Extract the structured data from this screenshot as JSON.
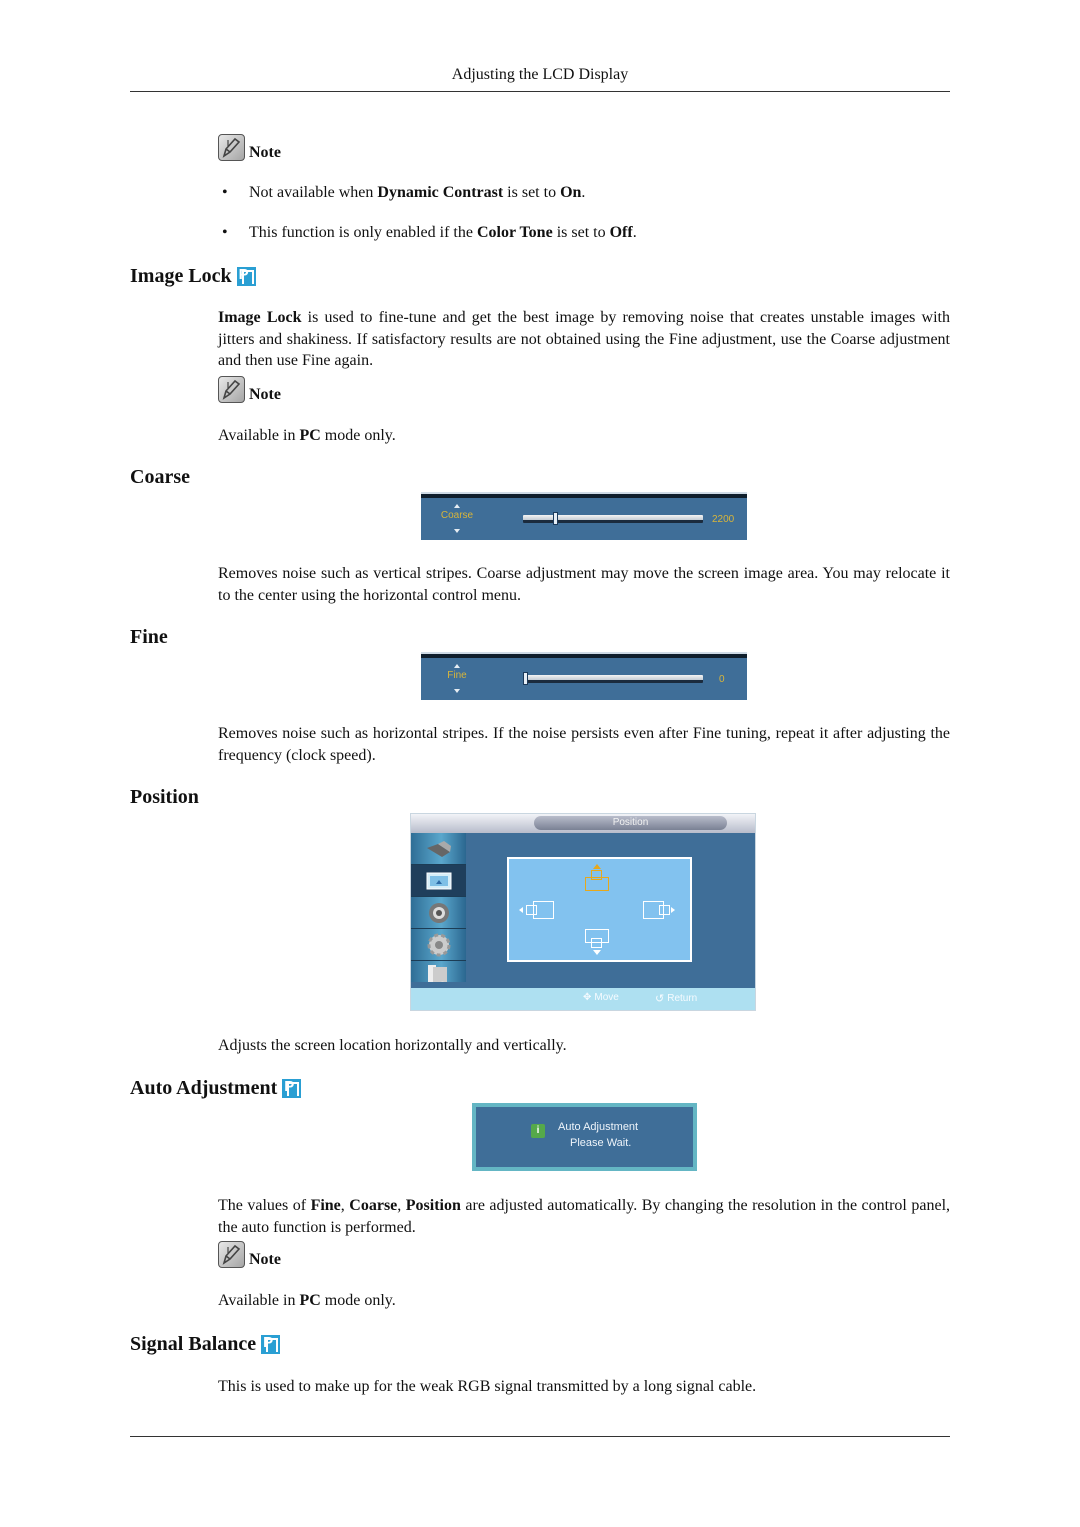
{
  "header": {
    "running_title": "Adjusting the LCD Display"
  },
  "note_label": "Note",
  "intro_note": {
    "items": [
      {
        "parts": [
          {
            "t": "Not available when ",
            "b": false
          },
          {
            "t": "Dynamic Contrast",
            "b": true
          },
          {
            "t": " is set to ",
            "b": false
          },
          {
            "t": "On",
            "b": true
          },
          {
            "t": ".",
            "b": false
          }
        ]
      },
      {
        "parts": [
          {
            "t": "This function is only enabled if the ",
            "b": false
          },
          {
            "t": "Color Tone",
            "b": true
          },
          {
            "t": " is set to ",
            "b": false
          },
          {
            "t": "Off",
            "b": true
          },
          {
            "t": ".",
            "b": false
          }
        ]
      }
    ]
  },
  "sections": {
    "image_lock": {
      "title": "Image Lock",
      "badge": "P",
      "body_bold": "Image Lock",
      "body_rest": " is used to fine-tune and get the best image by removing noise that creates unstable images with jitters and shakiness. If satisfactory results are not obtained using the Fine adjustment, use the Coarse adjustment and then use Fine again.",
      "note_pre": "Available in ",
      "note_bold": "PC",
      "note_post": " mode only."
    },
    "coarse": {
      "title": "Coarse",
      "osd_label": "Coarse",
      "osd_value": "2200",
      "slider_fraction": 0.17,
      "body": "Removes noise such as vertical stripes. Coarse adjustment may move the screen image area. You may relocate it to the center using the horizontal control menu."
    },
    "fine": {
      "title": "Fine",
      "osd_label": "Fine",
      "osd_value": "0",
      "slider_fraction": 0.0,
      "body": "Removes noise such as horizontal stripes. If the noise persists even after Fine tuning, repeat it after adjusting the frequency (clock speed)."
    },
    "position": {
      "title": "Position",
      "osd_title": "Position",
      "osd_sidebar": [
        "input-icon",
        "picture-icon",
        "sound-icon",
        "setup-icon",
        "multi-control-icon"
      ],
      "osd_active_index": 1,
      "hint_move": "Move",
      "hint_return": "Return",
      "body": "Adjusts the screen location horizontally and vertically."
    },
    "auto_adjustment": {
      "title": "Auto Adjustment",
      "badge": "P",
      "osd_line1": "Auto Adjustment",
      "osd_line2": "Please Wait.",
      "osd_icon": "i",
      "body_parts": [
        {
          "t": "The values of ",
          "b": false
        },
        {
          "t": "Fine",
          "b": true
        },
        {
          "t": ", ",
          "b": false
        },
        {
          "t": "Coarse",
          "b": true
        },
        {
          "t": ", ",
          "b": false
        },
        {
          "t": "Position",
          "b": true
        },
        {
          "t": " are adjusted automatically. By changing the resolution in the control panel, the auto function is performed.",
          "b": false
        }
      ],
      "note_pre": "Available in ",
      "note_bold": "PC",
      "note_post": " mode only."
    },
    "signal_balance": {
      "title": "Signal Balance",
      "badge": "P",
      "body": "This is used to make up for the weak RGB signal transmitted by a long signal cable."
    }
  },
  "colors": {
    "osd_blue": "#3f6e98",
    "osd_label_gold": "#d8b53a",
    "p_badge": "#2a9fd3",
    "panel_light_blue": "#82c2ef",
    "selected_orange": "#e7a81b"
  }
}
